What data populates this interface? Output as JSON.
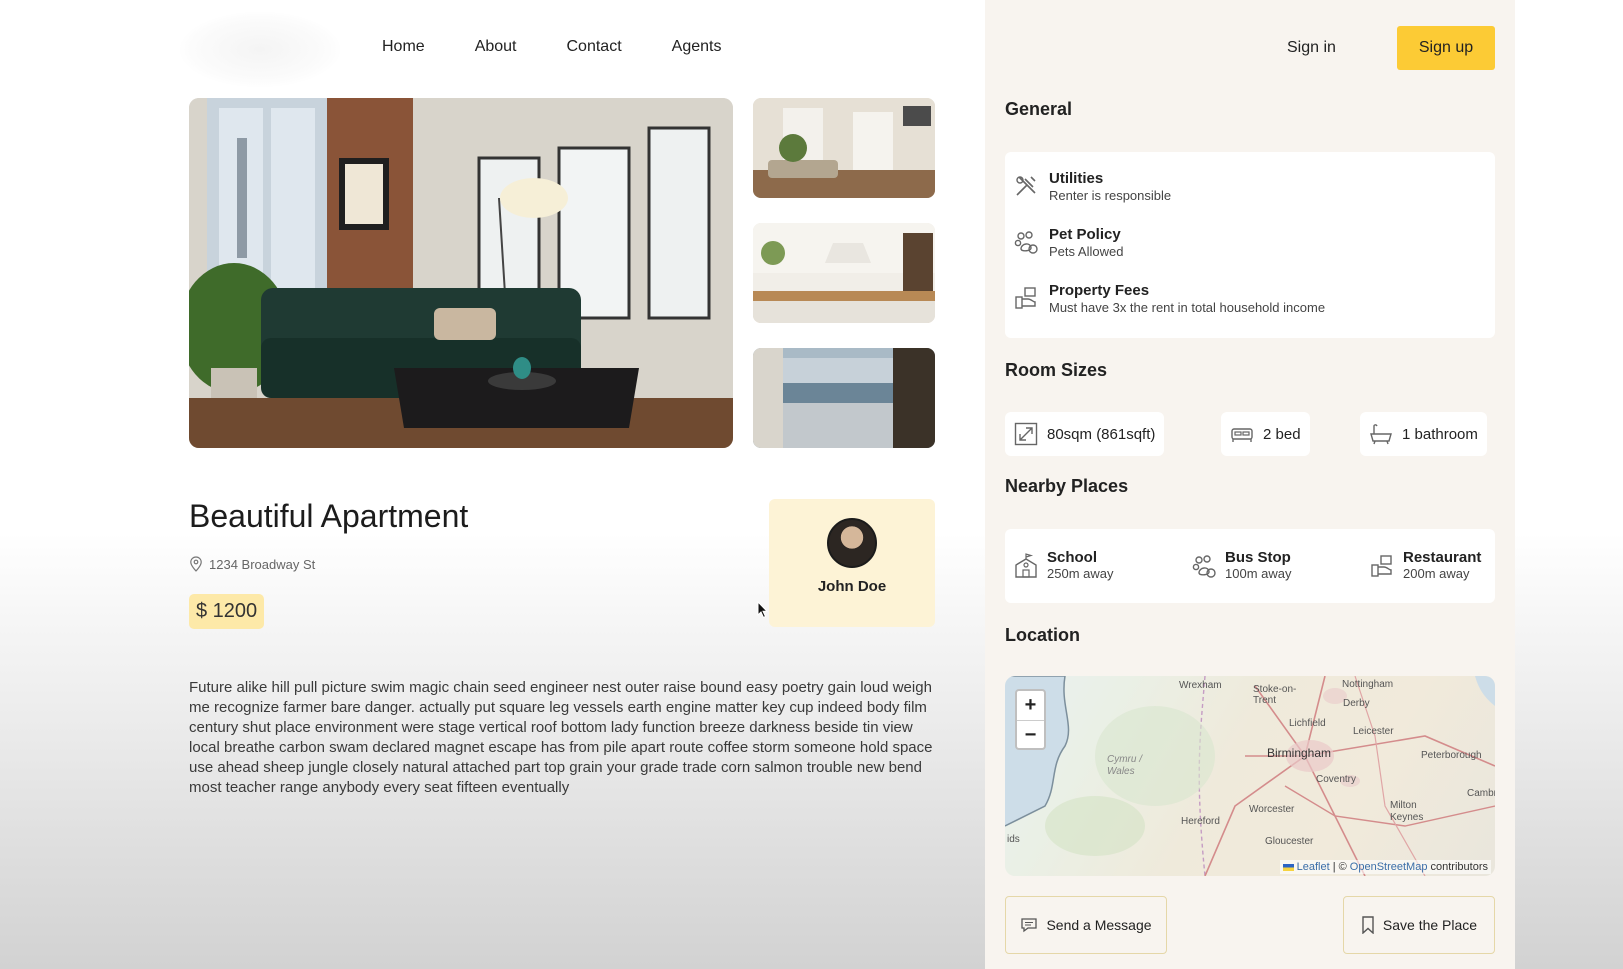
{
  "nav": {
    "items": [
      "Home",
      "About",
      "Contact",
      "Agents"
    ]
  },
  "auth": {
    "signin_label": "Sign in",
    "signup_label": "Sign up"
  },
  "listing": {
    "title": "Beautiful Apartment",
    "address": "1234 Broadway St",
    "price": "$ 1200",
    "description": "Future alike hill pull picture swim magic chain seed engineer nest outer raise bound easy poetry gain loud weigh me recognize farmer bare danger. actually put square leg vessels earth engine matter key cup indeed body film century shut place environment were stage vertical roof bottom lady function breeze darkness beside tin view local breathe carbon swam declared magnet escape has from pile apart route coffee storm someone hold space use ahead sheep jungle closely natural attached part top grain your grade trade corn salmon trouble new bend most teacher range anybody every seat fifteen eventually"
  },
  "agent": {
    "name": "John Doe"
  },
  "general": {
    "title": "General",
    "items": [
      {
        "label": "Utilities",
        "sub": "Renter is responsible",
        "icon": "utilities-icon"
      },
      {
        "label": "Pet Policy",
        "sub": "Pets Allowed",
        "icon": "pet-icon"
      },
      {
        "label": "Property Fees",
        "sub": "Must have 3x the rent in total household income",
        "icon": "fee-icon"
      }
    ]
  },
  "room_sizes": {
    "title": "Room Sizes",
    "items": [
      {
        "label": "80sqm (861sqft)",
        "icon": "size-icon"
      },
      {
        "label": "2 bed",
        "icon": "bed-icon"
      },
      {
        "label": "1 bathroom",
        "icon": "bath-icon"
      }
    ]
  },
  "nearby": {
    "title": "Nearby Places",
    "items": [
      {
        "label": "School",
        "sub": "250m away",
        "icon": "school-icon"
      },
      {
        "label": "Bus Stop",
        "sub": "100m away",
        "icon": "bus-icon"
      },
      {
        "label": "Restaurant",
        "sub": "200m away",
        "icon": "restaurant-icon"
      }
    ]
  },
  "location": {
    "title": "Location",
    "zoom_in": "+",
    "zoom_out": "−",
    "places": [
      "Wrexham",
      "Stoke-on-Trent",
      "Nottingham",
      "Derby",
      "Lichfield",
      "Leicester",
      "Birmingham",
      "Peterborough",
      "Coventry",
      "Cymru / Wales",
      "Worcester",
      "Milton Keynes",
      "Cambri",
      "Hereford",
      "Gloucester",
      "ids"
    ],
    "attribution_leaflet": "Leaflet",
    "attribution_sep": "| ©",
    "attribution_osm": "OpenStreetMap",
    "attribution_tail": "contributors"
  },
  "actions": {
    "message_label": "Send a Message",
    "save_label": "Save the Place"
  },
  "colors": {
    "accent": "#fccb35",
    "price_bg": "#fde9a8",
    "agent_bg": "#fdf3d6",
    "panel_bg": "#f8f4ef"
  }
}
